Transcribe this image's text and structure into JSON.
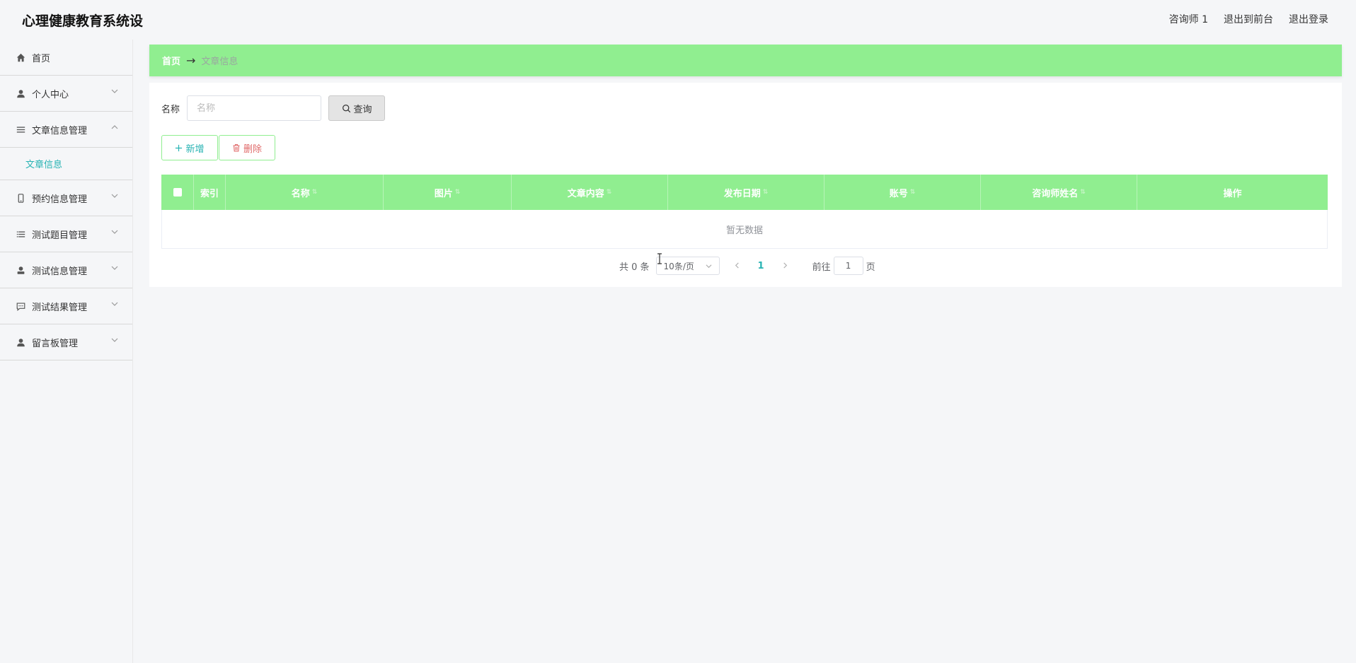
{
  "header": {
    "title": "心理健康教育系统设",
    "user": "咨询师 1",
    "to_front": "退出到前台",
    "logout": "退出登录"
  },
  "sidebar": {
    "items": [
      {
        "label": "首页",
        "icon": "home-icon"
      },
      {
        "label": "个人中心",
        "icon": "user-icon"
      },
      {
        "label": "文章信息管理",
        "icon": "list-icon",
        "expanded": true,
        "children": [
          {
            "label": "文章信息"
          }
        ]
      },
      {
        "label": "预约信息管理",
        "icon": "phone-icon"
      },
      {
        "label": "测试题目管理",
        "icon": "list-icon"
      },
      {
        "label": "测试信息管理",
        "icon": "user-icon"
      },
      {
        "label": "测试结果管理",
        "icon": "chat-icon"
      },
      {
        "label": "留言板管理",
        "icon": "user-icon"
      }
    ]
  },
  "breadcrumb": {
    "home": "首页",
    "separator": "→",
    "current": "文章信息"
  },
  "search": {
    "label": "名称",
    "placeholder": "名称",
    "value": "",
    "button": "查询"
  },
  "actions": {
    "add": "新增",
    "delete": "删除"
  },
  "table": {
    "columns": [
      "索引",
      "名称",
      "图片",
      "文章内容",
      "发布日期",
      "账号",
      "咨询师姓名",
      "操作"
    ],
    "empty_text": "暂无数据",
    "rows": []
  },
  "pagination": {
    "total": "共 0 条",
    "page_size": "10条/页",
    "current_page": "1",
    "goto_label": "前往",
    "goto_value": "1",
    "page_suffix": "页"
  },
  "colors": {
    "accent_green": "#90ee90",
    "link_teal": "#28b3b3",
    "danger": "#e06a6a"
  }
}
